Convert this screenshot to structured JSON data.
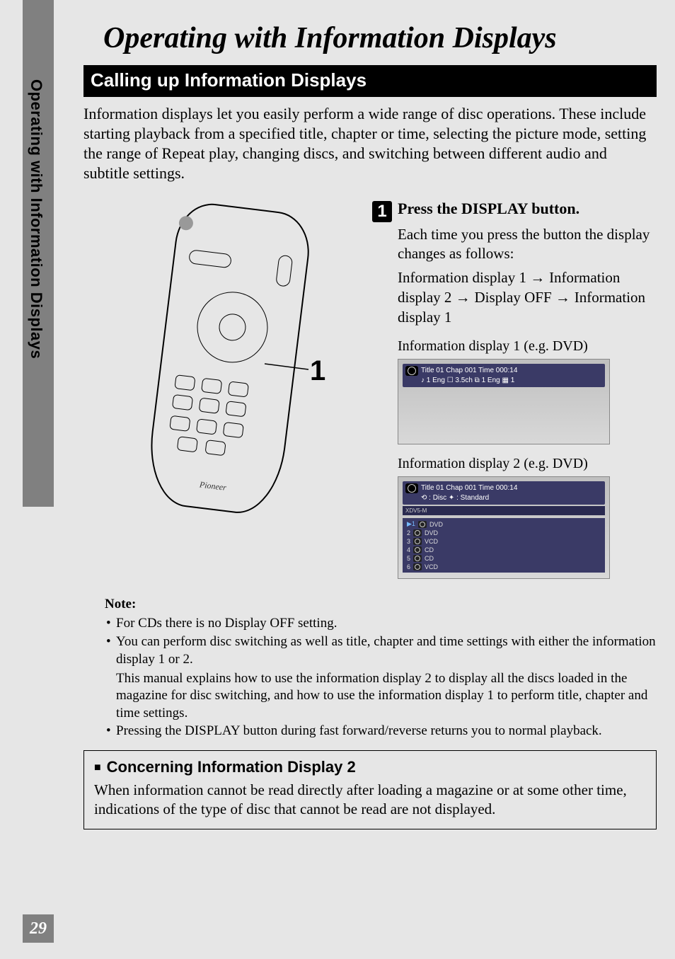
{
  "sidebar": {
    "label": "Operating with Information Displays"
  },
  "page_number": "29",
  "main_title": "Operating with Information Displays",
  "section_bar": "Calling up Information Displays",
  "intro": "Information displays let you easily perform a wide range of disc operations. These include starting playback from a specified title, chapter or time, selecting the picture mode, setting the range of Repeat play, changing discs, and switching between different audio and subtitle settings.",
  "remote_caption": "1",
  "step": {
    "num": "1",
    "title": "Press the DISPLAY button.",
    "body1": "Each time you press the button the display changes as follows:",
    "body2_a": "Information display 1",
    "body2_b": "Information display 2",
    "body2_c": "Display OFF",
    "body2_d": "Information display 1"
  },
  "osd1": {
    "label": "Information display 1 (e.g. DVD)",
    "line1": "Title 01  Chap 001  Time 000:14",
    "line2": "♪ 1 Eng   ☐   3.5ch   ⧉ 1 Eng   ▦ 1"
  },
  "osd2": {
    "label": "Information display 2 (e.g. DVD)",
    "line1": "Title 01  Chap 001  Time 000:14",
    "line2": "⟲ : Disc         ✦ : Standard",
    "magazine_label": "XDV5-M",
    "list": [
      {
        "idx": "▶1",
        "type": "DVD"
      },
      {
        "idx": "  2",
        "type": "DVD"
      },
      {
        "idx": "  3",
        "type": "VCD"
      },
      {
        "idx": "  4",
        "type": "CD"
      },
      {
        "idx": "  5",
        "type": "CD"
      },
      {
        "idx": "  6",
        "type": "VCD"
      }
    ]
  },
  "note": {
    "title": "Note:",
    "items": [
      "For CDs there is no Display OFF setting.",
      "You can perform disc switching as well as title, chapter and time settings with either the information display 1 or 2."
    ],
    "sub": "This manual explains how to use the information display 2 to display all the discs loaded in the magazine for disc switching, and how to use the information display 1 to perform title, chapter and time settings.",
    "item3": "Pressing the DISPLAY button during fast forward/reverse returns you to normal playback."
  },
  "concern": {
    "title": "Concerning Information Display 2",
    "body": "When information cannot be read directly after loading a magazine or at some other time, indications of the type of disc that cannot be read are not displayed."
  }
}
